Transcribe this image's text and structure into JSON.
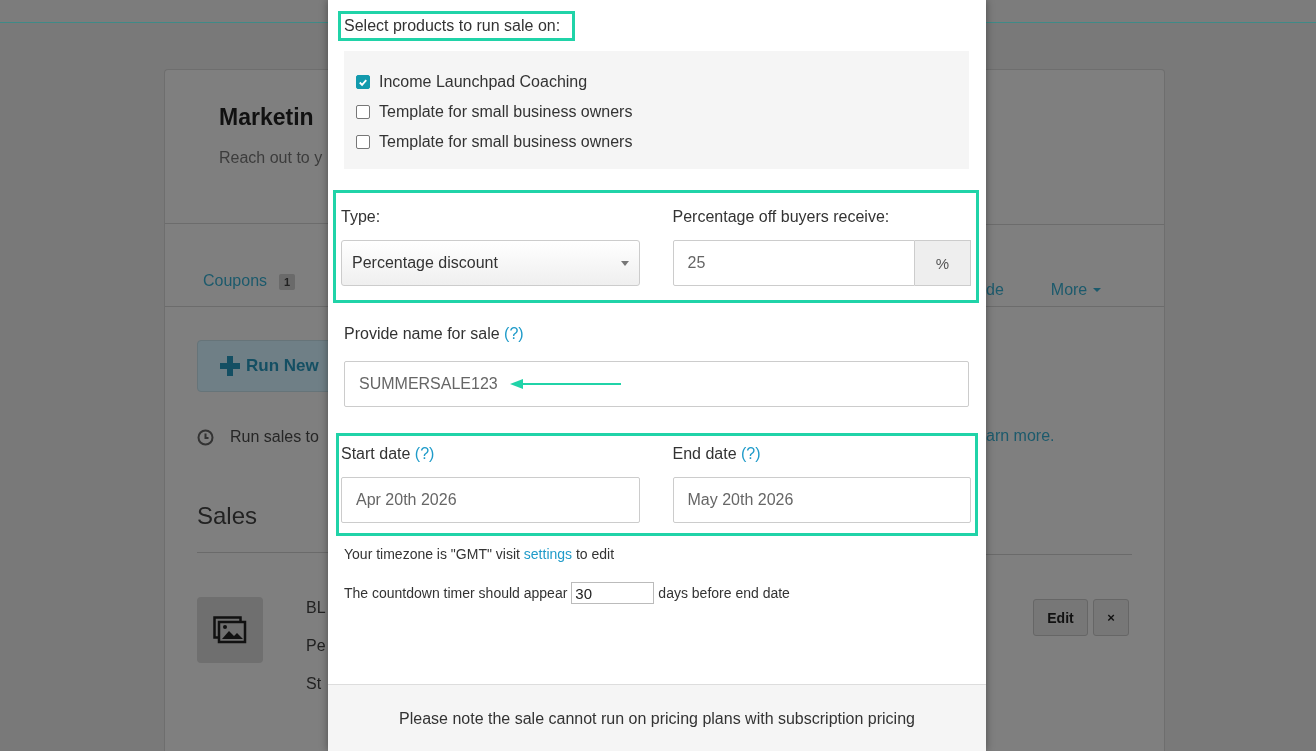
{
  "page": {
    "title": "Marketin",
    "subtitle": "Reach out to y",
    "tabs": [
      {
        "label": "Coupons",
        "kind": "link",
        "badge": "1"
      },
      {
        "label": "de",
        "kind": "link"
      },
      {
        "label": "More",
        "kind": "dropdown"
      }
    ],
    "run_button": "Run New",
    "info_text": "Run sales to",
    "info_link": "arn more.",
    "section_title": "Sales",
    "sale_lines": [
      "BL",
      "Pe",
      "St"
    ],
    "sale_buttons": [
      {
        "label": "Edit",
        "kind": "text"
      },
      {
        "label": "×",
        "kind": "remove"
      }
    ]
  },
  "modal": {
    "products_label": "Select products to run sale on:",
    "products": [
      {
        "label": "Income Launchpad Coaching",
        "checked": true
      },
      {
        "label": "Template for small business owners",
        "checked": false
      },
      {
        "label": "Template for small business owners",
        "checked": false
      }
    ],
    "type_label": "Type:",
    "type_value": "Percentage discount",
    "percent_label": "Percentage off buyers receive:",
    "percent_value": "25",
    "percent_unit": "%",
    "name_label": "Provide name for sale",
    "name_help": "(?)",
    "name_value": "SUMMERSALE123",
    "start_label": "Start date",
    "start_help": "(?)",
    "start_value": "Apr 20th 2026",
    "end_label": "End date",
    "end_help": "(?)",
    "end_value": "May 20th 2026",
    "timezone": {
      "before": "Your timezone is \"GMT\" visit",
      "link": "settings",
      "after": "to edit"
    },
    "countdown": {
      "before": "The countdown timer should appear",
      "value": "30",
      "after": "days before end date"
    },
    "footer_note": "Please note the sale cannot run on pricing plans with subscription pricing"
  }
}
